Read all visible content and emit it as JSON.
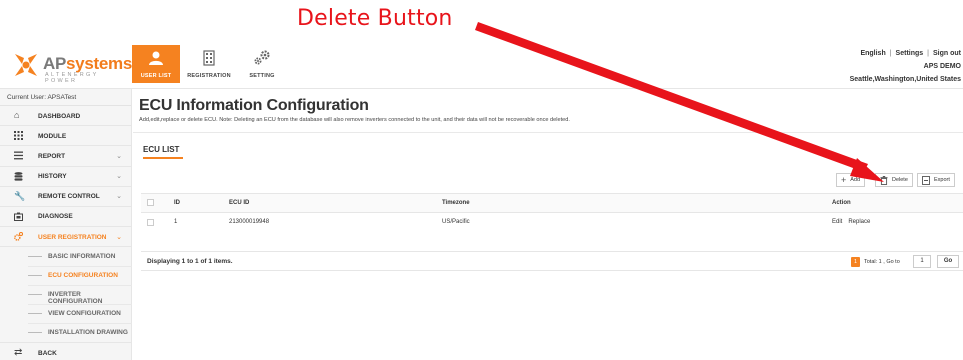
{
  "annotation": {
    "text": "Delete Button",
    "color": "#e8141b"
  },
  "brand": {
    "name_a": "AP",
    "name_b": "systems",
    "tagline": "ALTENERGY POWER",
    "accent": "#f58220"
  },
  "nav": [
    {
      "label": "USER LIST",
      "icon": "user-icon",
      "active": true
    },
    {
      "label": "REGISTRATION",
      "icon": "building-icon",
      "active": false
    },
    {
      "label": "SETTING",
      "icon": "gears-icon",
      "active": false
    }
  ],
  "header_links": {
    "language": "English",
    "settings": "Settings",
    "sign_out": "Sign out",
    "user_name": "APS DEMO",
    "location": "Seattle,Washington,United States"
  },
  "sidebar": {
    "current_user": "Current User: APSATest",
    "items": [
      {
        "label": "DASHBOARD",
        "icon": "home-icon"
      },
      {
        "label": "MODULE",
        "icon": "grid-icon"
      },
      {
        "label": "REPORT",
        "icon": "report-icon"
      },
      {
        "label": "HISTORY",
        "icon": "database-icon"
      },
      {
        "label": "REMOTE CONTROL",
        "icon": "wrench-icon"
      },
      {
        "label": "DIAGNOSE",
        "icon": "diagnose-icon"
      },
      {
        "label": "USER REGISTRATION",
        "icon": "gears-icon"
      }
    ],
    "sub_items": [
      {
        "label": "BASIC INFORMATION"
      },
      {
        "label": "ECU CONFIGURATION",
        "active": true
      },
      {
        "label": "INVERTER CONFIGURATION"
      },
      {
        "label": "VIEW CONFIGURATION"
      },
      {
        "label": "INSTALLATION DRAWING"
      }
    ],
    "back": "BACK"
  },
  "main": {
    "title": "ECU Information Configuration",
    "description": "Add,edit,replace or delete ECU. Note: Deleting an ECU from the database will also remove inverters connected to the unit, and their data will not be recoverable once deleted.",
    "section_title": "ECU LIST",
    "toolbar": {
      "add": "Add",
      "delete": "Delete",
      "export": "Export"
    },
    "table": {
      "headers": {
        "id": "ID",
        "ecu_id": "ECU ID",
        "timezone": "Timezone",
        "action": "Action"
      },
      "rows": [
        {
          "id": "1",
          "ecu_id": "213000019948",
          "timezone": "US/Pacific",
          "actions": [
            "Edit",
            "Replace"
          ]
        }
      ]
    },
    "pager": {
      "summary": "Displaying 1 to 1 of 1 items.",
      "current_page": "1",
      "total": "Total: 1 , Go to",
      "goto_value": "1",
      "go": "Go"
    }
  }
}
